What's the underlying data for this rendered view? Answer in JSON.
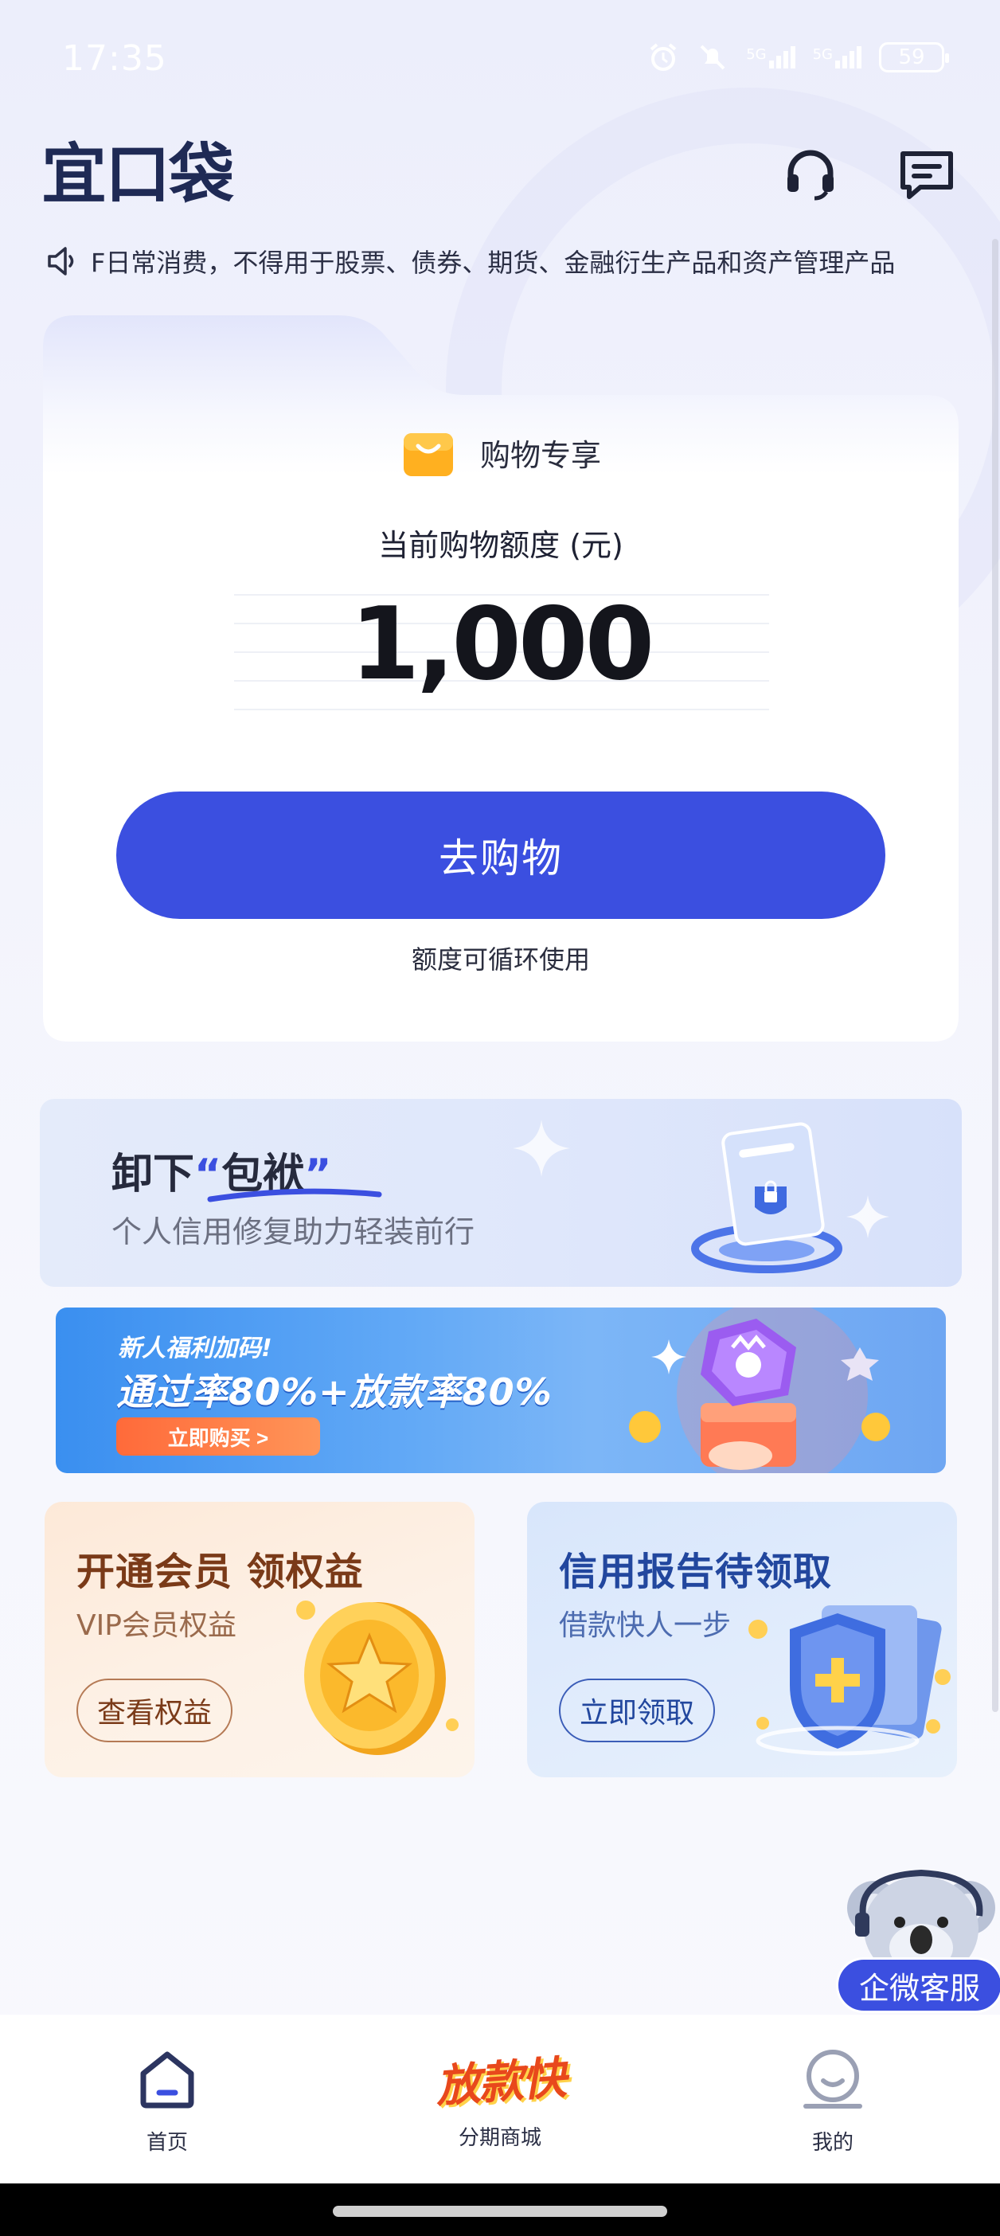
{
  "status_bar": {
    "time": "17:35",
    "battery": "59",
    "signal_labels": [
      "5G",
      "5G"
    ]
  },
  "header": {
    "logo": "宜口袋",
    "icons": [
      "headset-support-icon",
      "message-icon"
    ]
  },
  "notice": {
    "text": "F日常消费，不得用于股票、债券、期货、金融衍生产品和资产管理产品",
    "icon": "speaker-icon"
  },
  "credit_card": {
    "tag": "购物专享",
    "quota_label": "当前购物额度 (元)",
    "quota_value": "1,000",
    "button_label": "去购物",
    "note": "额度可循环使用"
  },
  "banner_repair": {
    "title_prefix": "卸下",
    "title_open_quote": "“",
    "title_keyword": "包袱",
    "title_close_quote": "”",
    "subtitle": "个人信用修复助力轻装前行"
  },
  "banner_newuser": {
    "tag": "新人福利加码!",
    "title": "通过率80%+放款率80%",
    "button_label": "立即购买 >"
  },
  "promo_vip": {
    "title": "开通会员  领权益",
    "subtitle": "VIP会员权益",
    "button_label": "查看权益"
  },
  "promo_credit": {
    "title": "信用报告待领取",
    "subtitle": "借款快人一步",
    "button_label": "立即领取"
  },
  "service": {
    "label": "企微客服"
  },
  "bottom_nav": {
    "home_label": "首页",
    "mall_logo": "放款快",
    "mall_label": "分期商城",
    "me_label": "我的"
  },
  "colors": {
    "primary": "#3b4fe0",
    "logo": "#1f2a55",
    "vip_title": "#7a3a18",
    "credit_title": "#22479e"
  }
}
